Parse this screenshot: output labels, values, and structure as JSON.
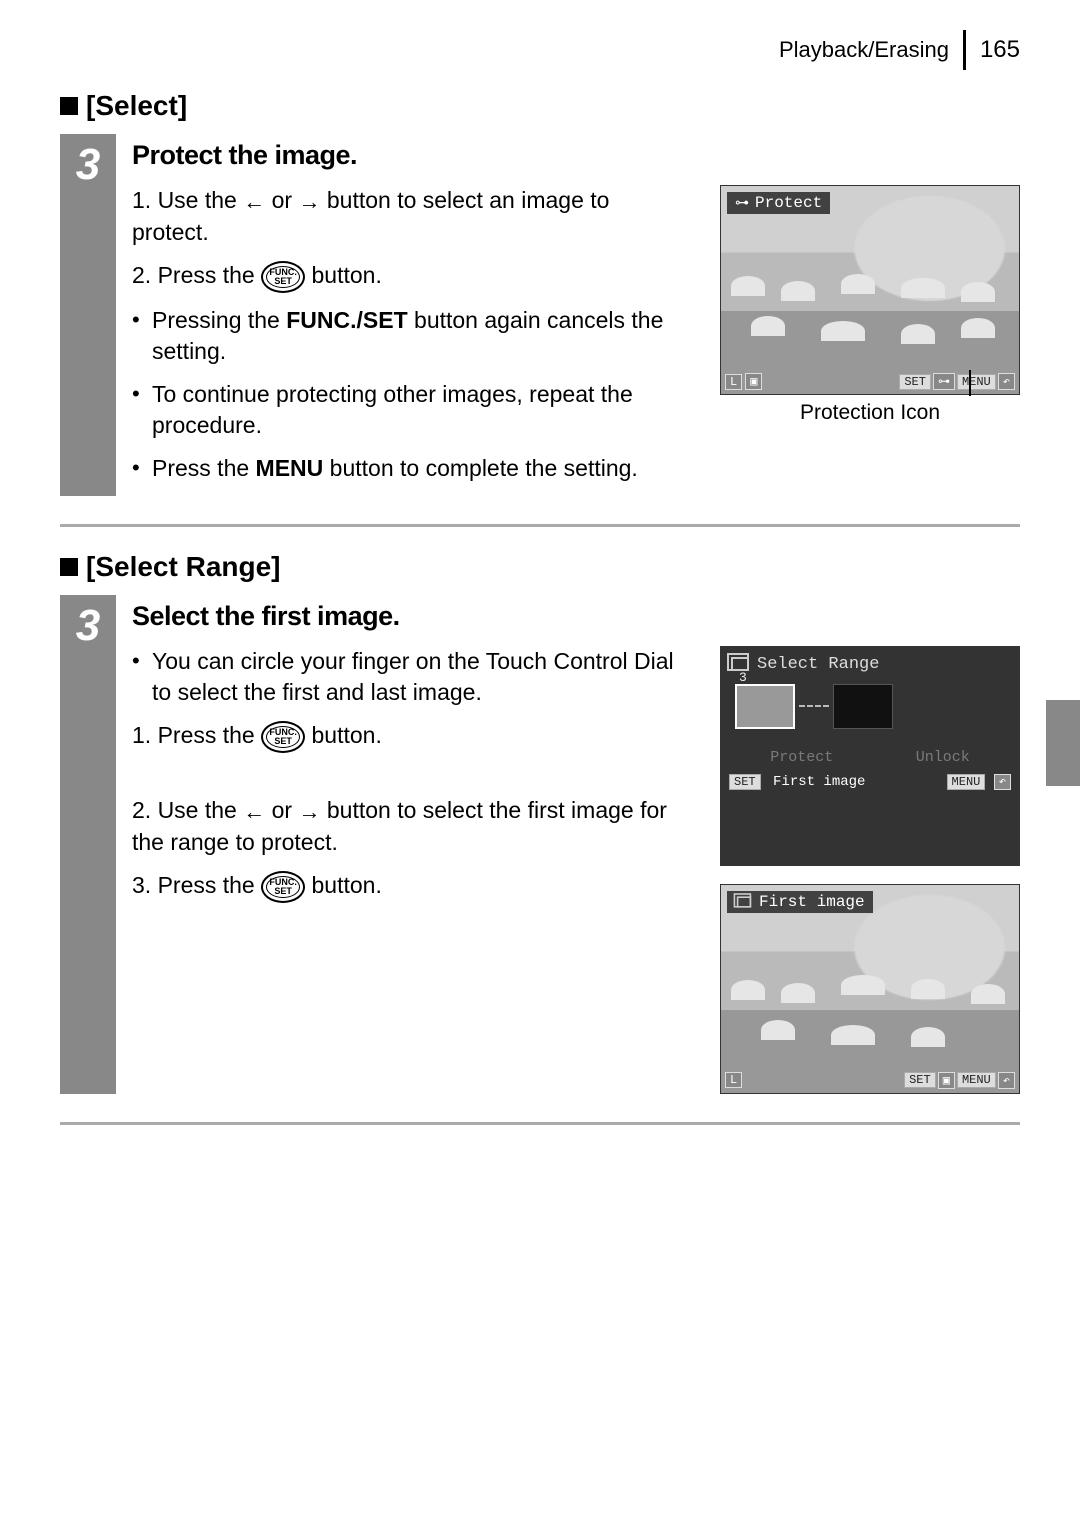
{
  "header": {
    "section": "Playback/Erasing",
    "page": "165"
  },
  "select": {
    "title": "[Select]",
    "stepnum": "3",
    "heading": "Protect the image.",
    "li1a": "1. Use the ",
    "li1b": " or ",
    "li1c": " button to select an image to protect.",
    "li2a": "2. Press the ",
    "li2b": " button.",
    "b1a": "Pressing the ",
    "b1bold": "FUNC./SET",
    "b1b": " button again cancels the setting.",
    "b2": "To continue protecting other images, repeat the procedure.",
    "b3a": "Press the ",
    "b3bold": "MENU",
    "b3b": " button to complete the setting.",
    "lcd_label": "Protect",
    "lcd_set": "SET",
    "lcd_menu": "MENU",
    "caption": "Protection Icon"
  },
  "range": {
    "title": "[Select Range]",
    "stepnum": "3",
    "heading": "Select the first image.",
    "tip": "You can circle your finger on the Touch Control Dial to select the first and last image.",
    "li1a": "1. Press the ",
    "li1b": " button.",
    "li2a": "2. Use the ",
    "li2b": " or ",
    "li2c": " button to select the first image for the range to protect.",
    "li3a": "3. Press the ",
    "li3b": " button.",
    "lcd_title": "Select Range",
    "thumb_num": "3",
    "opt_protect": "Protect",
    "opt_unlock": "Unlock",
    "set": "SET",
    "first_image": "First image",
    "menu": "MENU",
    "lcd2_label": "First image"
  },
  "icons": {
    "func_top": "FUNC.",
    "func_bot": "SET",
    "arrow_left": "←",
    "arrow_right": "→",
    "key": "⊶",
    "undo": "↶"
  }
}
